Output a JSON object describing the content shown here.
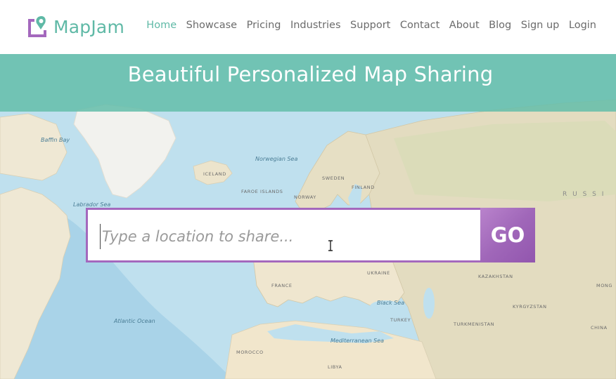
{
  "header": {
    "logo_text": "MapJam",
    "nav": [
      {
        "label": "Home",
        "active": true
      },
      {
        "label": "Showcase",
        "active": false
      },
      {
        "label": "Pricing",
        "active": false
      },
      {
        "label": "Industries",
        "active": false
      },
      {
        "label": "Support",
        "active": false
      },
      {
        "label": "Contact",
        "active": false
      },
      {
        "label": "About",
        "active": false
      },
      {
        "label": "Blog",
        "active": false
      },
      {
        "label": "Sign up",
        "active": false
      },
      {
        "label": "Login",
        "active": false
      }
    ]
  },
  "banner": {
    "title": "Beautiful Personalized Map Sharing"
  },
  "search": {
    "placeholder": "Type a location to share...",
    "value": "",
    "go_label": "GO"
  },
  "map_labels": {
    "norwegian_sea": "Norwegian Sea",
    "labrador_sea": "Labrador Sea",
    "atlantic": "Atlantic Ocean",
    "iceland": "ICELAND",
    "faroe": "FAROE ISLANDS",
    "sweden": "SWEDEN",
    "finland": "FINLAND",
    "norway": "NORWAY",
    "russia": "R U S S I",
    "kazakhstan": "KAZAKHSTAN",
    "ukraine": "UKRAINE",
    "france": "FRANCE",
    "black_sea": "Black Sea",
    "mediterranean": "Mediterranean Sea",
    "morocco": "MOROCCO",
    "libya": "LIBYA",
    "turkey": "TURKEY",
    "turkmenistan": "TURKMENISTAN",
    "kyrgyzstan": "KYRGYZSTAN",
    "mongolia": "MONG",
    "china": "CHINA",
    "baffin": "Baffin Bay"
  },
  "colors": {
    "brand": "#5fb9a6",
    "accent": "#a468bd",
    "banner": "#64beaa",
    "ocean": "#bfe0ee",
    "land": "#efe8d4"
  }
}
